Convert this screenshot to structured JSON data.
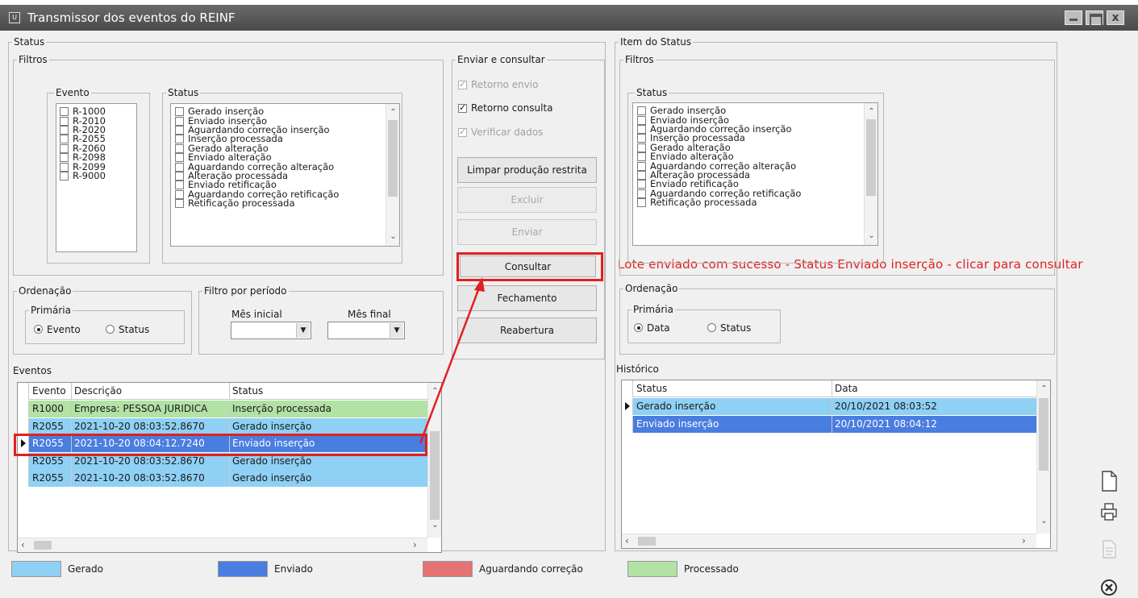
{
  "window": {
    "title": "Transmissor dos eventos do REINF",
    "sys_icon": "U",
    "close_glyph": "x"
  },
  "left_group": {
    "title": "Status",
    "filters_title": "Filtros",
    "evento_title": "Evento",
    "evento_items": [
      "R-1000",
      "R-2010",
      "R-2020",
      "R-2055",
      "R-2060",
      "R-2098",
      "R-2099",
      "R-9000"
    ],
    "status_title": "Status",
    "status_items": [
      "Gerado inserção",
      "Enviado inserção",
      "Aguardando correção inserção",
      "Inserção processada",
      "Gerado alteração",
      "Enviado alteração",
      "Aguardando correção alteração",
      "Alteração processada",
      "Enviado retificação",
      "Aguardando correção retificação",
      "Retificação processada"
    ],
    "ordenacao_title": "Ordenação",
    "primaria_title": "Primária",
    "radio_evento": "Evento",
    "radio_status": "Status",
    "periodo_title": "Filtro por período",
    "mes_inicial": "Mês inicial",
    "mes_final": "Mês final",
    "eventos_title": "Eventos",
    "grid_headers": [
      "Evento",
      "Descrição",
      "Status"
    ],
    "grid_rows": [
      {
        "evento": "R1000",
        "descricao": "Empresa: PESSOA JURIDICA",
        "status": "Inserção processada",
        "color": "#b2e2a4"
      },
      {
        "evento": "R2055",
        "descricao": "2021-10-20 08:03:52.8670",
        "status": "Gerado inserção",
        "color": "#8fd0f5"
      },
      {
        "evento": "R2055",
        "descricao": "2021-10-20 08:04:12.7240",
        "status": "Enviado inserção",
        "color": "#4a7de0"
      },
      {
        "evento": "R2055",
        "descricao": "2021-10-20 08:03:52.8670",
        "status": "Gerado inserção",
        "color": "#8fd0f5"
      },
      {
        "evento": "R2055",
        "descricao": "2021-10-20 08:03:52.8670",
        "status": "Gerado inserção",
        "color": "#8fd0f5"
      }
    ]
  },
  "actions": {
    "title": "Enviar e consultar",
    "cb_retorno_envio": "Retorno envio",
    "cb_retorno_consulta": "Retorno consulta",
    "cb_verificar_dados": "Verificar dados",
    "btn_limpar": "Limpar produção restrita",
    "btn_excluir": "Excluir",
    "btn_enviar": "Enviar",
    "btn_consultar": "Consultar",
    "btn_fechamento": "Fechamento",
    "btn_reabertura": "Reabertura"
  },
  "annotation": {
    "text": "Lote enviado com sucesso - Status Enviado inserção - clicar para consultar",
    "color": "#e02020"
  },
  "right_group": {
    "title": "Item do Status",
    "filters_title": "Filtros",
    "status_title": "Status",
    "status_items": [
      "Gerado inserção",
      "Enviado inserção",
      "Aguardando correção inserção",
      "Inserção processada",
      "Gerado alteração",
      "Enviado alteração",
      "Aguardando correção alteração",
      "Alteração processada",
      "Enviado retificação",
      "Aguardando correção retificação",
      "Retificação processada"
    ],
    "ordenacao_title": "Ordenação",
    "primaria_title": "Primária",
    "radio_data": "Data",
    "radio_status": "Status",
    "historico_title": "Histórico",
    "grid_headers": [
      "Status",
      "Data"
    ],
    "grid_rows": [
      {
        "status": "Gerado inserção",
        "data": "20/10/2021 08:03:52",
        "color": "#8fd0f5"
      },
      {
        "status": "Enviado inserção",
        "data": "20/10/2021 08:04:12",
        "color": "#4a7de0"
      }
    ]
  },
  "legend": [
    {
      "label": "Gerado",
      "color": "#8fd0f5"
    },
    {
      "label": "Enviado",
      "color": "#4a7de0"
    },
    {
      "label": "Aguardando correção",
      "color": "#e57373"
    },
    {
      "label": "Processado",
      "color": "#b2e2a4"
    }
  ],
  "side_icons": [
    "new-document-icon",
    "printer-icon",
    "document-disabled-icon",
    "close-circle-icon"
  ]
}
